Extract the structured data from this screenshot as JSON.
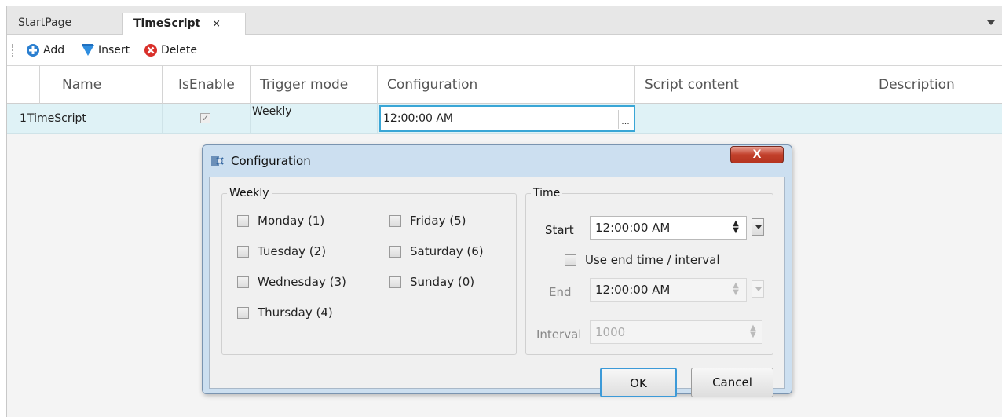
{
  "tabs": {
    "start": "StartPage",
    "active": "TimeScript",
    "close_glyph": "×"
  },
  "toolbar": {
    "add": "Add",
    "insert": "Insert",
    "delete": "Delete"
  },
  "grid": {
    "headers": [
      "Name",
      "IsEnable",
      "Trigger mode",
      "Configuration",
      "Script content",
      "Description"
    ],
    "rows": [
      {
        "num": "1",
        "name": "TimeScript",
        "is_enable": "✓",
        "trigger_mode": "Weekly",
        "configuration": "12:00:00 AM",
        "ellipsis": "...",
        "script_content": "",
        "description": ""
      }
    ]
  },
  "dialog": {
    "title": "Configuration",
    "close_glyph": "X",
    "weekly_legend": "Weekly",
    "days": [
      "Monday (1)",
      "Tuesday (2)",
      "Wednesday (3)",
      "Thursday (4)",
      "Friday (5)",
      "Saturday (6)",
      "Sunday (0)"
    ],
    "time_legend": "Time",
    "start_label": "Start",
    "start_value": "12:00:00 AM",
    "use_end_label": "Use end time / interval",
    "end_label": "End",
    "end_value": "12:00:00 AM",
    "interval_label": "Interval",
    "interval_placeholder": "1000",
    "ok": "OK",
    "cancel": "Cancel"
  },
  "icons": {
    "add": "add-icon",
    "insert": "insert-arrow-icon",
    "delete": "delete-icon",
    "dialog": "configuration-app-icon"
  },
  "colors": {
    "selection_row": "#dff2f6",
    "focus_border": "#39a6d6",
    "dialog_frame": "#ccdff0"
  }
}
